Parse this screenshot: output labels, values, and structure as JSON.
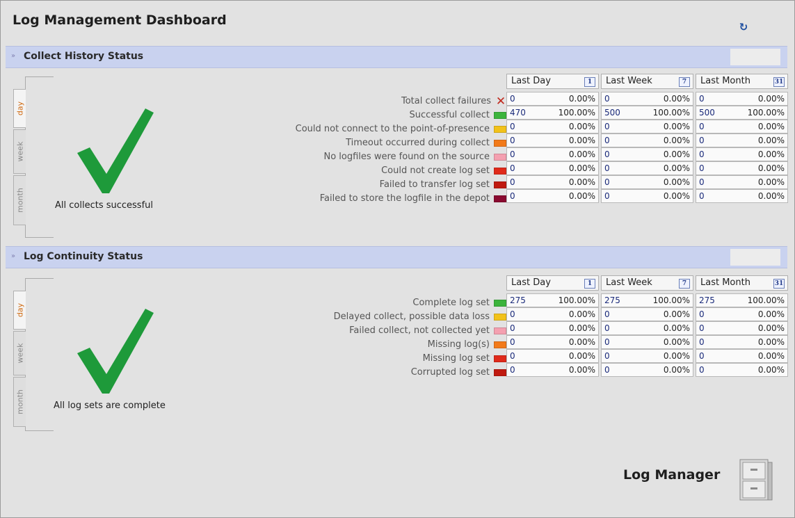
{
  "page": {
    "title": "Log Management Dashboard"
  },
  "icons": {
    "refresh": "refresh-icon",
    "collapse": "chevron-icon",
    "failure": "x-icon",
    "success": "checkmark-icon",
    "calendar": "calendar-icon",
    "logo": "file-cabinet-icon"
  },
  "colors": {
    "section_bar": "#c9d2ef",
    "check_green": "#1e9a3a",
    "tab_active_text": "#d06a10",
    "number_blue": "#1a2a7a"
  },
  "periods": [
    {
      "label": "Last Day",
      "calendar": "1"
    },
    {
      "label": "Last Week",
      "calendar": "7"
    },
    {
      "label": "Last Month",
      "calendar": "31"
    }
  ],
  "tabs": [
    "day",
    "week",
    "month"
  ],
  "collect": {
    "title": "Collect History Status",
    "status_message": "All collects successful",
    "rows": [
      {
        "label": "Total collect failures",
        "indicator": "x",
        "color": "#c0281c",
        "values": [
          [
            "0",
            "0.00%"
          ],
          [
            "0",
            "0.00%"
          ],
          [
            "0",
            "0.00%"
          ]
        ]
      },
      {
        "label": "Successful collect",
        "indicator": "swatch",
        "color": "#3cb43c",
        "values": [
          [
            "470",
            "100.00%"
          ],
          [
            "500",
            "100.00%"
          ],
          [
            "500",
            "100.00%"
          ]
        ]
      },
      {
        "label": "Could not connect to the point-of-presence",
        "indicator": "swatch",
        "color": "#f2c21a",
        "values": [
          [
            "0",
            "0.00%"
          ],
          [
            "0",
            "0.00%"
          ],
          [
            "0",
            "0.00%"
          ]
        ]
      },
      {
        "label": "Timeout occurred during collect",
        "indicator": "swatch",
        "color": "#f27a1a",
        "values": [
          [
            "0",
            "0.00%"
          ],
          [
            "0",
            "0.00%"
          ],
          [
            "0",
            "0.00%"
          ]
        ]
      },
      {
        "label": "No logfiles were found on the source",
        "indicator": "swatch",
        "color": "#f4a0b0",
        "values": [
          [
            "0",
            "0.00%"
          ],
          [
            "0",
            "0.00%"
          ],
          [
            "0",
            "0.00%"
          ]
        ]
      },
      {
        "label": "Could not create log set",
        "indicator": "swatch",
        "color": "#e02a1a",
        "values": [
          [
            "0",
            "0.00%"
          ],
          [
            "0",
            "0.00%"
          ],
          [
            "0",
            "0.00%"
          ]
        ]
      },
      {
        "label": "Failed to transfer log set",
        "indicator": "swatch",
        "color": "#c01a10",
        "values": [
          [
            "0",
            "0.00%"
          ],
          [
            "0",
            "0.00%"
          ],
          [
            "0",
            "0.00%"
          ]
        ]
      },
      {
        "label": "Failed to store the logfile in the depot",
        "indicator": "swatch",
        "color": "#8a0a30",
        "values": [
          [
            "0",
            "0.00%"
          ],
          [
            "0",
            "0.00%"
          ],
          [
            "0",
            "0.00%"
          ]
        ]
      }
    ]
  },
  "continuity": {
    "title": "Log Continuity Status",
    "status_message": "All log sets are complete",
    "rows": [
      {
        "label": "Complete log set",
        "indicator": "swatch",
        "color": "#3cb43c",
        "values": [
          [
            "275",
            "100.00%"
          ],
          [
            "275",
            "100.00%"
          ],
          [
            "275",
            "100.00%"
          ]
        ]
      },
      {
        "label": "Delayed collect, possible data loss",
        "indicator": "swatch",
        "color": "#f2c21a",
        "values": [
          [
            "0",
            "0.00%"
          ],
          [
            "0",
            "0.00%"
          ],
          [
            "0",
            "0.00%"
          ]
        ]
      },
      {
        "label": "Failed collect, not collected yet",
        "indicator": "swatch",
        "color": "#f4a0b0",
        "values": [
          [
            "0",
            "0.00%"
          ],
          [
            "0",
            "0.00%"
          ],
          [
            "0",
            "0.00%"
          ]
        ]
      },
      {
        "label": "Missing log(s)",
        "indicator": "swatch",
        "color": "#f27a1a",
        "values": [
          [
            "0",
            "0.00%"
          ],
          [
            "0",
            "0.00%"
          ],
          [
            "0",
            "0.00%"
          ]
        ]
      },
      {
        "label": "Missing log set",
        "indicator": "swatch",
        "color": "#e02a1a",
        "values": [
          [
            "0",
            "0.00%"
          ],
          [
            "0",
            "0.00%"
          ],
          [
            "0",
            "0.00%"
          ]
        ]
      },
      {
        "label": "Corrupted log set",
        "indicator": "swatch",
        "color": "#c01a10",
        "values": [
          [
            "0",
            "0.00%"
          ],
          [
            "0",
            "0.00%"
          ],
          [
            "0",
            "0.00%"
          ]
        ]
      }
    ]
  },
  "brand": {
    "name": "Log Manager"
  }
}
